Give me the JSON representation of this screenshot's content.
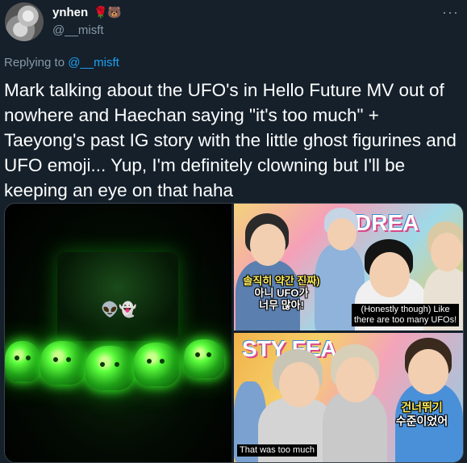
{
  "author": {
    "display_name": "ynhen",
    "emojis": [
      "🌹",
      "🐻"
    ],
    "handle": "@__misft"
  },
  "more_button": "···",
  "reply": {
    "prefix": "Replying to ",
    "mention": "@__misft"
  },
  "tweet": {
    "text": "Mark talking about the UFO's in Hello Future MV out of nowhere and Haechan saying \"it's too much\" + Taeyong's past IG story with the little ghost figurines and UFO emoji... Yup, I'm definitely clowning but I'll be keeping an eye on that haha"
  },
  "media": {
    "left_panel": {
      "emojis": "👽👻"
    },
    "top_right_panel": {
      "sign_text": "DREA",
      "korean_subtitle_line1": "솔직히 약간 진짜)",
      "korean_subtitle_line2": "아니 UFO가",
      "korean_subtitle_line3": "너무 많아!",
      "caption_line1": "(Honestly though) Like",
      "caption_line2": "there are too many UFOs!"
    },
    "bottom_right_panel": {
      "sign_text": "STY FEA",
      "korean_subtitle_line1": "건너뛰기",
      "korean_subtitle_line2": "수준이었어",
      "caption": "That was too much"
    }
  }
}
